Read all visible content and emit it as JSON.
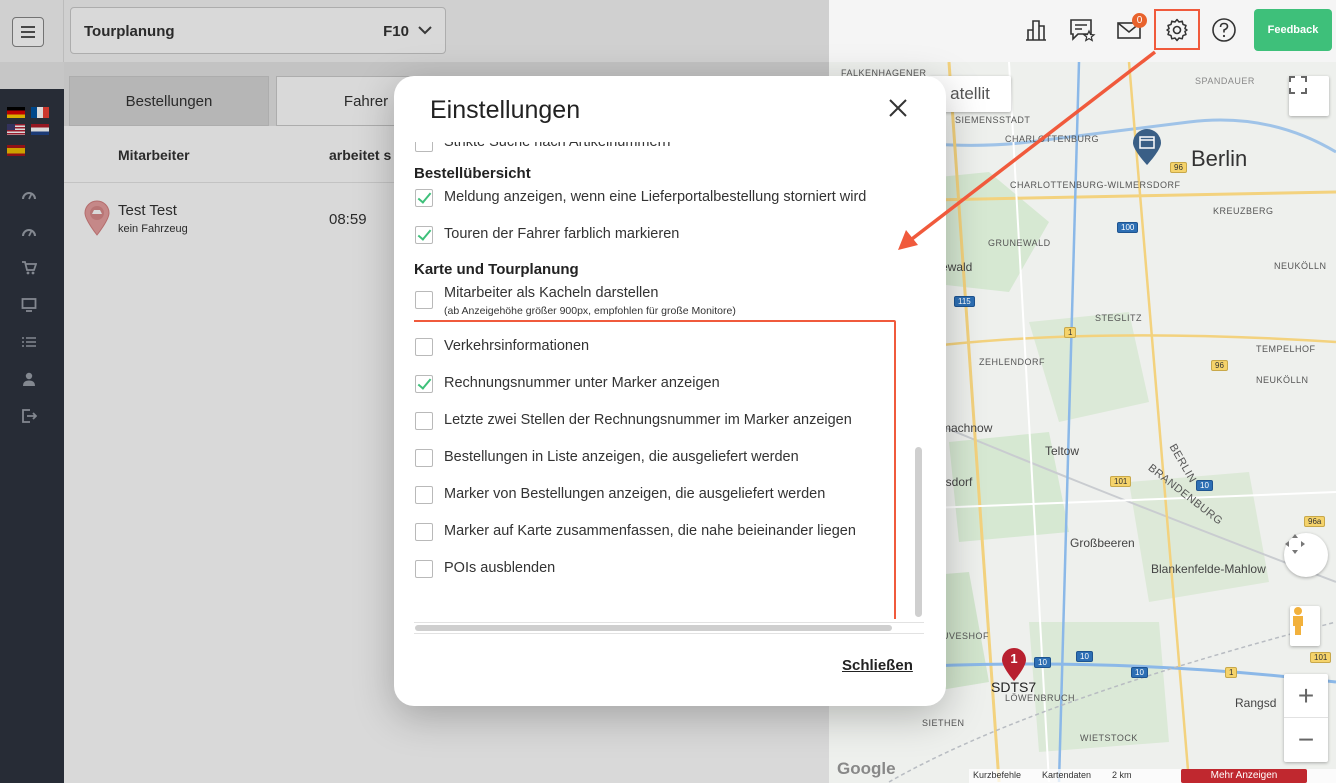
{
  "header": {
    "tour_label": "Tourplanung",
    "tour_value": "F10",
    "mail_count": "0",
    "feedback_label": "Feedback"
  },
  "tabs": [
    {
      "label": "Bestellungen"
    },
    {
      "label": "Fahrer"
    }
  ],
  "list": {
    "columns": [
      "Mitarbeiter",
      "arbeitet s"
    ],
    "rows": [
      {
        "name": "Test Test",
        "sub": "kein Fahrzeug",
        "time": "08:59"
      }
    ]
  },
  "modal": {
    "title": "Einstellungen",
    "partial_top_label": "Strikte Suche nach Artikelnummern",
    "section1": {
      "title": "Bestellübersicht",
      "options": [
        {
          "label": "Meldung anzeigen, wenn eine Lieferportalbestellung storniert wird",
          "checked": true
        },
        {
          "label": "Touren der Fahrer farblich markieren",
          "checked": true
        }
      ]
    },
    "section2": {
      "title": "Karte und Tourplanung",
      "options": [
        {
          "label": "Mitarbeiter als Kacheln darstellen",
          "sub": "(ab Anzeigehöhe größer 900px, empfohlen für große Monitore)",
          "checked": false
        },
        {
          "label": "Verkehrsinformationen",
          "checked": false
        },
        {
          "label": "Rechnungsnummer unter Marker anzeigen",
          "checked": true
        },
        {
          "label": "Letzte zwei Stellen der Rechnungsnummer im Marker anzeigen",
          "checked": false
        },
        {
          "label": "Bestellungen in Liste anzeigen, die ausgeliefert werden",
          "checked": false
        },
        {
          "label": "Marker von Bestellungen anzeigen, die ausgeliefert werden",
          "checked": false
        },
        {
          "label": "Marker auf Karte zusammenfassen, die nahe beieinander liegen",
          "checked": false
        },
        {
          "label": "POIs ausblenden",
          "checked": false
        }
      ]
    },
    "close_label": "Schließen"
  },
  "map": {
    "satellite": "atellit",
    "labels": {
      "berlin": "Berlin",
      "falkenhagener": "FALKENHAGENER",
      "siemensstadt": "SIEMENSSTADT",
      "charlottenburg": "CHARLOTTENBURG",
      "wilmersdorf": "CHARLOTTENBURG-WILMERSDORF",
      "kreuzberg": "KREUZBERG",
      "grunewald": "GRUNEWALD",
      "ewald": "ewald",
      "neukolln": "NEUKÖLLN",
      "steglitz": "STEGLITZ",
      "zehlendorf": "ZEHLENDORF",
      "tempelhof": "TEMPELHOF",
      "neukolln2": "NEUKÖLLN",
      "machnow": "machnow",
      "teltow": "Teltow",
      "berlin_state": "BERLIN",
      "brandenburg": "BRANDENBURG",
      "nsdorf": "nsdorf",
      "grossbeeren": "Großbeeren",
      "blankenfelde": "Blankenfelde-Mahlow",
      "truveshof": "TRUVESHOF",
      "lowenbruch": "LÖWENBRUCH",
      "siethen": "SIETHEN",
      "wietstock": "WIETSTOCK",
      "rangsd": "Rangsd",
      "spandauer": "SPANDAUER"
    },
    "roads": [
      "96",
      "100",
      "1",
      "115",
      "96",
      "101",
      "10",
      "96a",
      "10",
      "10",
      "10",
      "1",
      "101"
    ],
    "marker_number": "1",
    "marker_label": "SDTS7",
    "footer": {
      "google": "Google",
      "kurzbefehle": "Kurzbefehle",
      "kartendaten": "Kartendaten",
      "scale": "2 km",
      "mehr": "Mehr Anzeigen"
    }
  },
  "colors": {
    "accent_green": "#3ec07a",
    "highlight_red": "#f05a3c",
    "sidebar": "#2e3440"
  }
}
